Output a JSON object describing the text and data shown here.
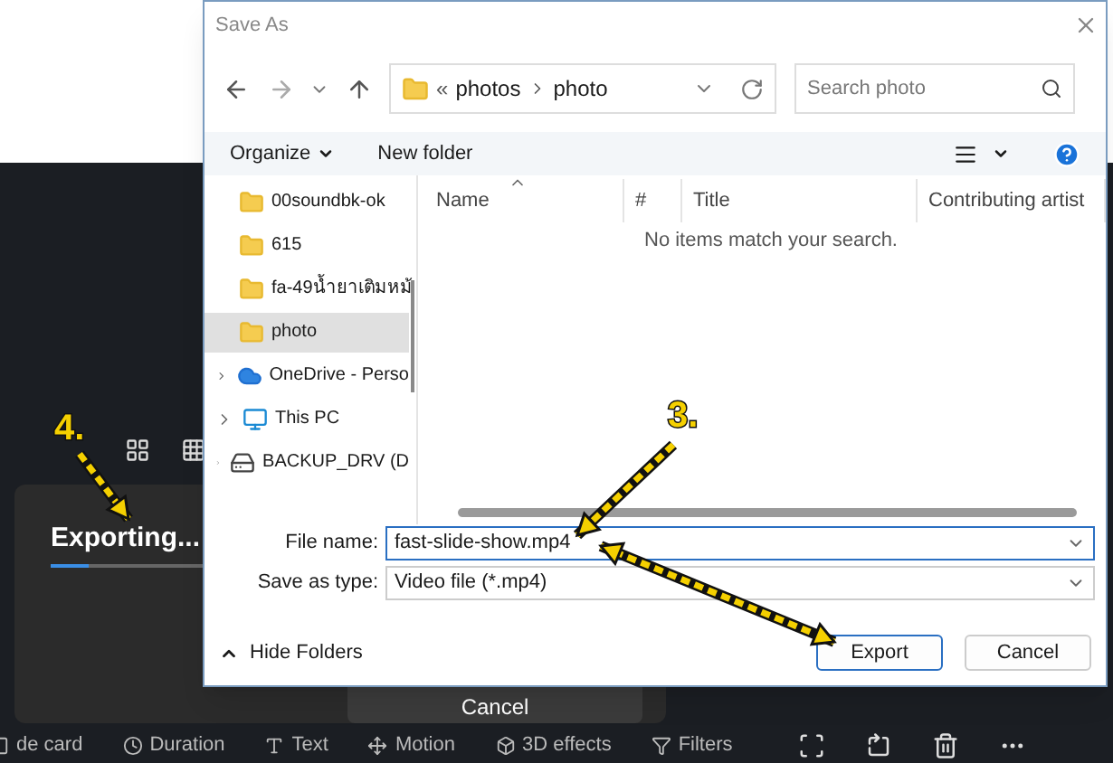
{
  "background_app": {
    "view_icons": [
      {
        "kind": "grid4"
      },
      {
        "kind": "grid9"
      }
    ],
    "export_panel": {
      "title": "Exporting...",
      "level": 0.07,
      "cancel": "Cancel"
    },
    "toolbar": [
      {
        "label": "de card",
        "kind": "card"
      },
      {
        "label": "Duration",
        "kind": "clock"
      },
      {
        "label": "Text",
        "kind": "text"
      },
      {
        "label": "Motion",
        "kind": "motion"
      },
      {
        "label": "3D effects",
        "kind": "effects"
      },
      {
        "label": "Filters",
        "kind": "filters"
      }
    ],
    "tools": [
      {
        "kind": "crop"
      },
      {
        "kind": "rotate"
      },
      {
        "kind": "trash"
      },
      {
        "kind": "more"
      }
    ]
  },
  "dialog": {
    "title": "Save As",
    "address": {
      "prefix": "«",
      "crumbs": [
        "photos",
        "photo"
      ]
    },
    "search": {
      "placeholder": "Search photo"
    },
    "commands": [
      {
        "label": "Organize",
        "menu": true
      },
      {
        "label": "New folder",
        "menu": false
      }
    ],
    "nav_items": [
      {
        "label": "00soundbk-ok",
        "kind": "folder",
        "expandable": false,
        "selected": false
      },
      {
        "label": "615",
        "kind": "folder",
        "expandable": false,
        "selected": false
      },
      {
        "label": "fa-49น้ำยาเติมหม้",
        "kind": "folder",
        "expandable": false,
        "selected": false
      },
      {
        "label": "photo",
        "kind": "folder",
        "expandable": false,
        "selected": true
      },
      {
        "label": "OneDrive - Perso",
        "kind": "cloud",
        "expandable": true,
        "selected": false
      },
      {
        "label": "This PC",
        "kind": "pc",
        "expandable": true,
        "selected": false
      },
      {
        "label": "BACKUP_DRV (D",
        "kind": "drive",
        "expandable": true,
        "selected": false
      }
    ],
    "columns": [
      {
        "label": "Name",
        "sorted": true
      },
      {
        "label": "#",
        "sorted": false
      },
      {
        "label": "Title",
        "sorted": false
      },
      {
        "label": "Contributing artist",
        "sorted": false
      }
    ],
    "empty_message": "No items match your search.",
    "fields": [
      {
        "label": "File name:",
        "value": "fast-slide-show.mp4",
        "focused": true
      },
      {
        "label": "Save as type:",
        "value": "Video file (*.mp4)",
        "focused": false
      }
    ],
    "hide_folders": "Hide Folders",
    "buttons": [
      {
        "label": "Export",
        "default": true
      },
      {
        "label": "Cancel",
        "default": false
      }
    ]
  },
  "annotations": [
    {
      "label": "4."
    },
    {
      "label": "3."
    }
  ]
}
